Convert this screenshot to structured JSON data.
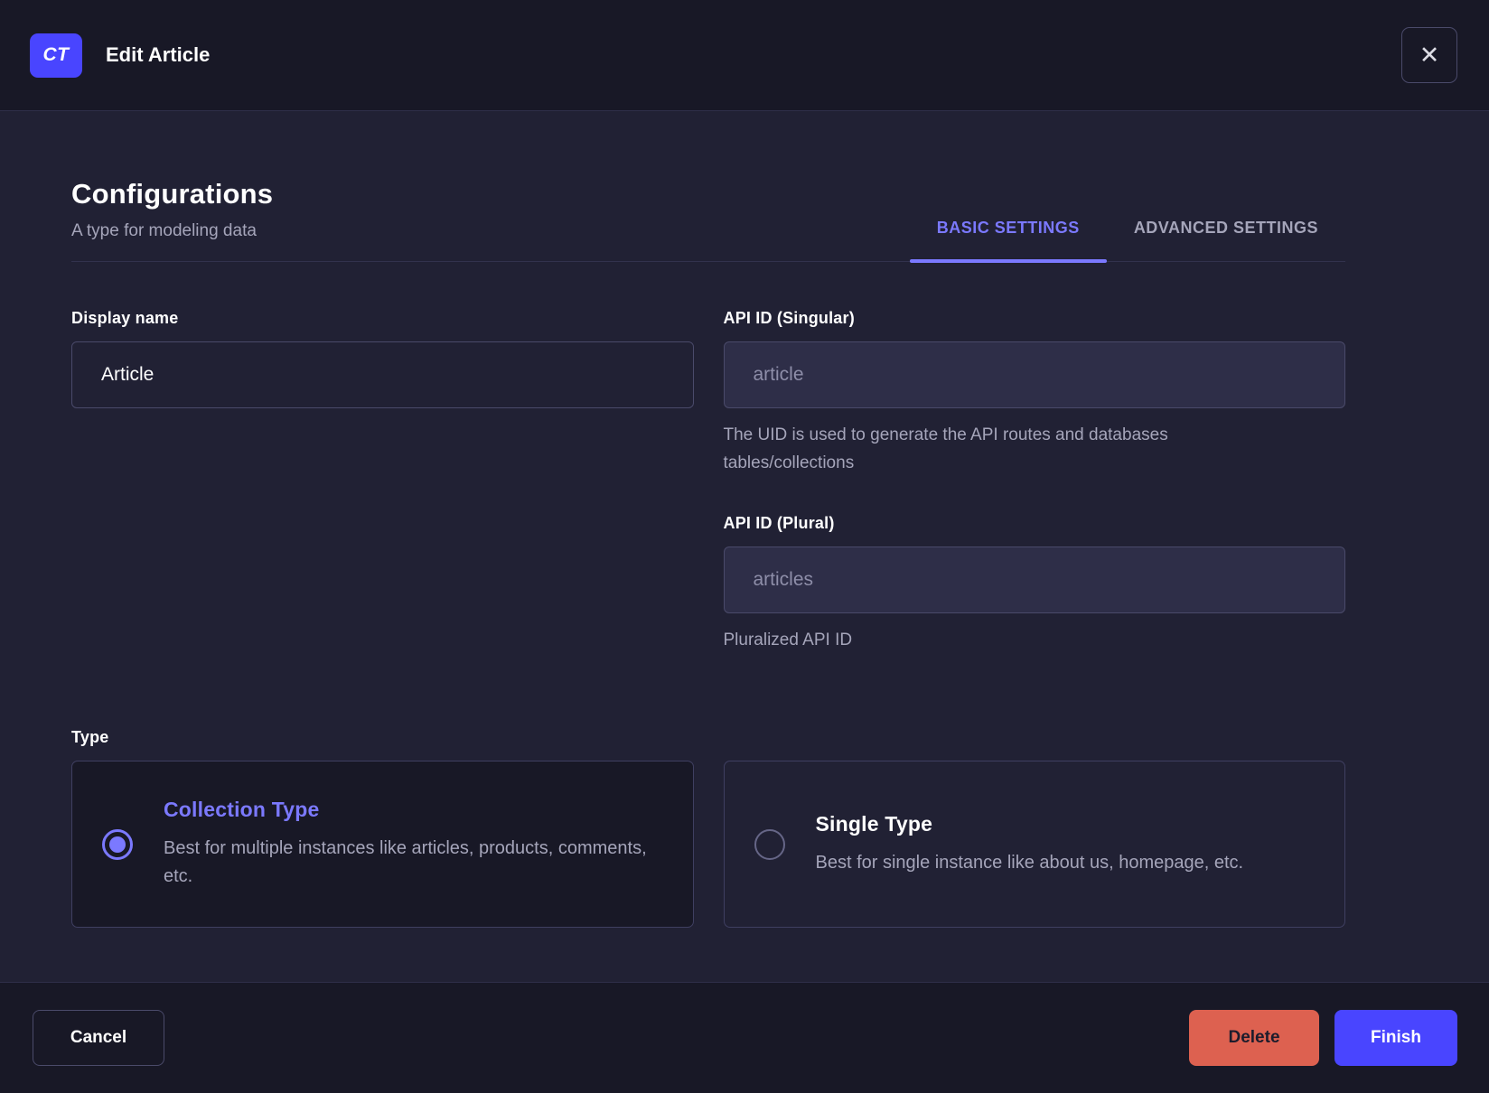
{
  "header": {
    "badge": "CT",
    "title": "Edit Article",
    "close_icon": "✕"
  },
  "main": {
    "title": "Configurations",
    "subtitle": "A type for modeling data",
    "tabs": [
      {
        "label": "BASIC SETTINGS",
        "active": true
      },
      {
        "label": "ADVANCED SETTINGS",
        "active": false
      }
    ],
    "fields": {
      "display_name": {
        "label": "Display name",
        "value": "Article"
      },
      "api_id_singular": {
        "label": "API ID (Singular)",
        "placeholder": "article",
        "hint": "The UID is used to generate the API routes and databases tables/collections"
      },
      "api_id_plural": {
        "label": "API ID (Plural)",
        "placeholder": "articles",
        "hint": "Pluralized API ID"
      }
    },
    "type": {
      "label": "Type",
      "options": [
        {
          "title": "Collection Type",
          "description": "Best for multiple instances like articles, products, comments, etc.",
          "selected": true
        },
        {
          "title": "Single Type",
          "description": "Best for single instance like about us, homepage, etc.",
          "selected": false
        }
      ]
    }
  },
  "footer": {
    "cancel": "Cancel",
    "delete": "Delete",
    "finish": "Finish"
  },
  "colors": {
    "accent": "#4945ff",
    "accent_light": "#7b79ff",
    "danger": "#dd6150",
    "bg_dark": "#181826",
    "bg_body": "#212134",
    "text_muted": "#a5a5ba",
    "border": "#4a4a6a"
  }
}
